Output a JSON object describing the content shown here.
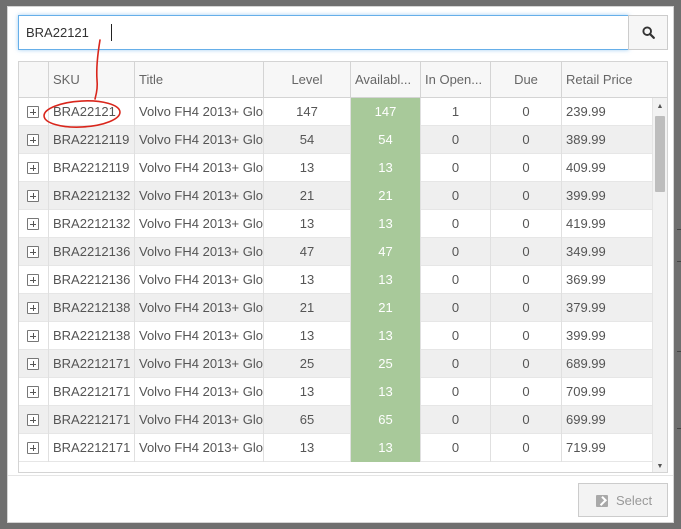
{
  "search": {
    "value": "BRA22121"
  },
  "grid": {
    "columns": [
      "SKU",
      "Title",
      "Level",
      "Availabl...",
      "In Open...",
      "Due",
      "Retail Price"
    ],
    "rows": [
      {
        "sku": "BRA22121",
        "title": "Volvo FH4 2013+ Glo",
        "level": "147",
        "available": "147",
        "in_open": "1",
        "due": "0",
        "retail": "239.99"
      },
      {
        "sku": "BRA2212119",
        "title": "Volvo FH4 2013+ Glo",
        "level": "54",
        "available": "54",
        "in_open": "0",
        "due": "0",
        "retail": "389.99"
      },
      {
        "sku": "BRA2212119",
        "title": "Volvo FH4 2013+ Glo",
        "level": "13",
        "available": "13",
        "in_open": "0",
        "due": "0",
        "retail": "409.99"
      },
      {
        "sku": "BRA2212132",
        "title": "Volvo FH4 2013+ Glo",
        "level": "21",
        "available": "21",
        "in_open": "0",
        "due": "0",
        "retail": "399.99"
      },
      {
        "sku": "BRA2212132",
        "title": "Volvo FH4 2013+ Glo",
        "level": "13",
        "available": "13",
        "in_open": "0",
        "due": "0",
        "retail": "419.99"
      },
      {
        "sku": "BRA2212136",
        "title": "Volvo FH4 2013+ Glo",
        "level": "47",
        "available": "47",
        "in_open": "0",
        "due": "0",
        "retail": "349.99"
      },
      {
        "sku": "BRA2212136",
        "title": "Volvo FH4 2013+ Glo",
        "level": "13",
        "available": "13",
        "in_open": "0",
        "due": "0",
        "retail": "369.99"
      },
      {
        "sku": "BRA2212138",
        "title": "Volvo FH4 2013+ Glo",
        "level": "21",
        "available": "21",
        "in_open": "0",
        "due": "0",
        "retail": "379.99"
      },
      {
        "sku": "BRA2212138",
        "title": "Volvo FH4 2013+ Glo",
        "level": "13",
        "available": "13",
        "in_open": "0",
        "due": "0",
        "retail": "399.99"
      },
      {
        "sku": "BRA2212171",
        "title": "Volvo FH4 2013+ Glo",
        "level": "25",
        "available": "25",
        "in_open": "0",
        "due": "0",
        "retail": "689.99"
      },
      {
        "sku": "BRA2212171",
        "title": "Volvo FH4 2013+ Glo",
        "level": "13",
        "available": "13",
        "in_open": "0",
        "due": "0",
        "retail": "709.99"
      },
      {
        "sku": "BRA2212171",
        "title": "Volvo FH4 2013+ Glo",
        "level": "65",
        "available": "65",
        "in_open": "0",
        "due": "0",
        "retail": "699.99"
      },
      {
        "sku": "BRA2212171",
        "title": "Volvo FH4 2013+ Glo",
        "level": "13",
        "available": "13",
        "in_open": "0",
        "due": "0",
        "retail": "719.99"
      }
    ]
  },
  "footer": {
    "select_label": "Select"
  },
  "icons": {
    "search": "search-icon",
    "expand": "plus-square-icon",
    "select": "checkbox-icon"
  },
  "colors": {
    "available_column": "#a8c99a",
    "focus_border": "#66afe9",
    "annotation": "#d9261c"
  }
}
